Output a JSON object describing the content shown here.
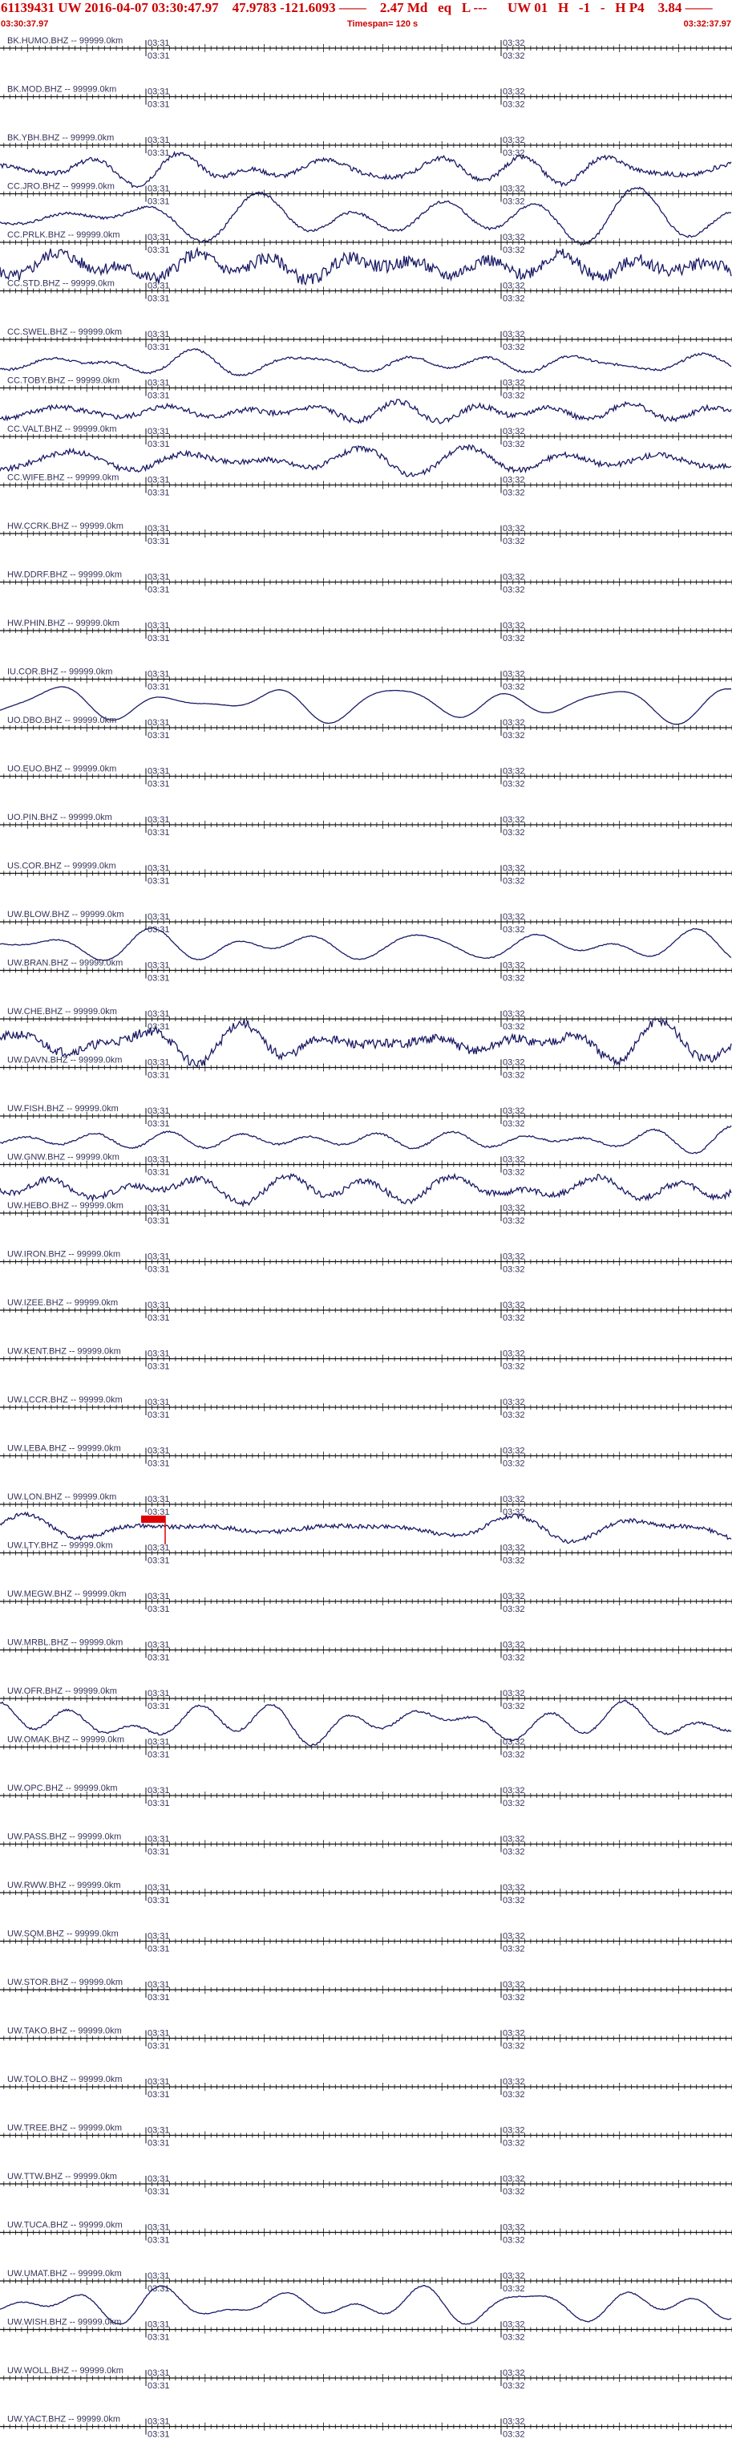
{
  "header": {
    "title": "61139431 UW 2016-04-07 03:30:47.97    47.9783 -121.6093 ——    2.47 Md   eq   L ---      UW 01   H   -1   -   H P4    3.84 ——",
    "start_time": "03:30:37.97",
    "timespan": "Timespan= 120 s",
    "end_time": "03:32:37.97"
  },
  "colors": {
    "header_text": "#cc0000",
    "trace": "#1a1a66",
    "axis": "#111111",
    "label": "#33335a",
    "pick": "#dd0000"
  },
  "chart_data": {
    "type": "line",
    "title": "61139431 UW 2016-04-07 03:30:47.97",
    "timespan_s": 120,
    "minute_labels": [
      "03:31",
      "03:32"
    ],
    "stations": [
      {
        "name": "BK.HUMO.BHZ -- 99999.0km",
        "active": false,
        "amplitude": 0,
        "seed": 1,
        "noise": 0
      },
      {
        "name": "BK.MOD.BHZ -- 99999.0km",
        "active": false,
        "amplitude": 0,
        "seed": 2,
        "noise": 0
      },
      {
        "name": "BK.YBH.BHZ -- 99999.0km",
        "active": true,
        "amplitude": 14,
        "seed": 3,
        "noise": 0.25
      },
      {
        "name": "CC.JRO.BHZ -- 99999.0km",
        "active": true,
        "amplitude": 20,
        "seed": 4,
        "noise": 0.1
      },
      {
        "name": "CC.PRLK.BHZ -- 99999.0km",
        "active": true,
        "amplitude": 16,
        "seed": 5,
        "noise": 0.6
      },
      {
        "name": "CC.STD.BHZ -- 99999.0km",
        "active": false,
        "amplitude": 0,
        "seed": 6,
        "noise": 0
      },
      {
        "name": "CC.SWEL.BHZ -- 99999.0km",
        "active": true,
        "amplitude": 12,
        "seed": 7,
        "noise": 0.15
      },
      {
        "name": "CC.TOBY.BHZ -- 99999.0km",
        "active": true,
        "amplitude": 12,
        "seed": 8,
        "noise": 0.35
      },
      {
        "name": "CC.VALT.BHZ -- 99999.0km",
        "active": true,
        "amplitude": 14,
        "seed": 9,
        "noise": 0.3
      },
      {
        "name": "CC.WIFE.BHZ -- 99999.0km",
        "active": false,
        "amplitude": 0,
        "seed": 10,
        "noise": 0
      },
      {
        "name": "HW.CCRK.BHZ -- 99999.0km",
        "active": false,
        "amplitude": 0,
        "seed": 11,
        "noise": 0
      },
      {
        "name": "HW.DDRF.BHZ -- 99999.0km",
        "active": false,
        "amplitude": 0,
        "seed": 12,
        "noise": 0
      },
      {
        "name": "HW.PHIN.BHZ -- 99999.0km",
        "active": false,
        "amplitude": 0,
        "seed": 13,
        "noise": 0
      },
      {
        "name": "IU.COR.BHZ -- 99999.0km",
        "active": true,
        "amplitude": 14,
        "seed": 14,
        "noise": 0.02
      },
      {
        "name": "UO.DBO.BHZ -- 99999.0km",
        "active": false,
        "amplitude": 0,
        "seed": 15,
        "noise": 0
      },
      {
        "name": "UO.EUO.BHZ -- 99999.0km",
        "active": false,
        "amplitude": 0,
        "seed": 16,
        "noise": 0
      },
      {
        "name": "UO.PIN.BHZ -- 99999.0km",
        "active": false,
        "amplitude": 0,
        "seed": 17,
        "noise": 0
      },
      {
        "name": "US.COR.BHZ -- 99999.0km",
        "active": false,
        "amplitude": 0,
        "seed": 18,
        "noise": 0
      },
      {
        "name": "UW.BLOW.BHZ -- 99999.0km",
        "active": true,
        "amplitude": 14,
        "seed": 19,
        "noise": 0.05
      },
      {
        "name": "UW.BRAN.BHZ -- 99999.0km",
        "active": false,
        "amplitude": 0,
        "seed": 20,
        "noise": 0
      },
      {
        "name": "UW.CHE.BHZ -- 99999.0km",
        "active": true,
        "amplitude": 18,
        "seed": 21,
        "noise": 0.4
      },
      {
        "name": "UW.DAVN.BHZ -- 99999.0km",
        "active": false,
        "amplitude": 0,
        "seed": 22,
        "noise": 0
      },
      {
        "name": "UW.FISH.BHZ -- 99999.0km",
        "active": true,
        "amplitude": 14,
        "seed": 23,
        "noise": 0.1
      },
      {
        "name": "UW.GNW.BHZ -- 99999.0km",
        "active": true,
        "amplitude": 16,
        "seed": 24,
        "noise": 0.3
      },
      {
        "name": "UW.HEBO.BHZ -- 99999.0km",
        "active": false,
        "amplitude": 0,
        "seed": 25,
        "noise": 0
      },
      {
        "name": "UW.IRON.BHZ -- 99999.0km",
        "active": false,
        "amplitude": 0,
        "seed": 26,
        "noise": 0
      },
      {
        "name": "UW.IZEE.BHZ -- 99999.0km",
        "active": false,
        "amplitude": 0,
        "seed": 27,
        "noise": 0
      },
      {
        "name": "UW.KENT.BHZ -- 99999.0km",
        "active": false,
        "amplitude": 0,
        "seed": 28,
        "noise": 0
      },
      {
        "name": "UW.LCCR.BHZ -- 99999.0km",
        "active": false,
        "amplitude": 0,
        "seed": 29,
        "noise": 0
      },
      {
        "name": "UW.LEBA.BHZ -- 99999.0km",
        "active": false,
        "amplitude": 0,
        "seed": 30,
        "noise": 0
      },
      {
        "name": "UW.LON.BHZ -- 99999.0km",
        "active": true,
        "amplitude": 13,
        "seed": 31,
        "noise": 0.25,
        "pick": true
      },
      {
        "name": "UW.LTY.BHZ -- 99999.0km",
        "active": false,
        "amplitude": 0,
        "seed": 32,
        "noise": 0
      },
      {
        "name": "UW.MEGW.BHZ -- 99999.0km",
        "active": false,
        "amplitude": 0,
        "seed": 33,
        "noise": 0
      },
      {
        "name": "UW.MRBL.BHZ -- 99999.0km",
        "active": false,
        "amplitude": 0,
        "seed": 34,
        "noise": 0
      },
      {
        "name": "UW.OFR.BHZ -- 99999.0km",
        "active": true,
        "amplitude": 16,
        "seed": 35,
        "noise": 0.1
      },
      {
        "name": "UW.OMAK.BHZ -- 99999.0km",
        "active": false,
        "amplitude": 0,
        "seed": 36,
        "noise": 0
      },
      {
        "name": "UW.OPC.BHZ -- 99999.0km",
        "active": false,
        "amplitude": 0,
        "seed": 37,
        "noise": 0
      },
      {
        "name": "UW.PASS.BHZ -- 99999.0km",
        "active": false,
        "amplitude": 0,
        "seed": 38,
        "noise": 0
      },
      {
        "name": "UW.RWW.BHZ -- 99999.0km",
        "active": false,
        "amplitude": 0,
        "seed": 39,
        "noise": 0
      },
      {
        "name": "UW.SQM.BHZ -- 99999.0km",
        "active": false,
        "amplitude": 0,
        "seed": 40,
        "noise": 0
      },
      {
        "name": "UW.STOR.BHZ -- 99999.0km",
        "active": false,
        "amplitude": 0,
        "seed": 41,
        "noise": 0
      },
      {
        "name": "UW.TAKO.BHZ -- 99999.0km",
        "active": false,
        "amplitude": 0,
        "seed": 42,
        "noise": 0
      },
      {
        "name": "UW.TOLO.BHZ -- 99999.0km",
        "active": false,
        "amplitude": 0,
        "seed": 43,
        "noise": 0
      },
      {
        "name": "UW.TREE.BHZ -- 99999.0km",
        "active": false,
        "amplitude": 0,
        "seed": 44,
        "noise": 0
      },
      {
        "name": "UW.TTW.BHZ -- 99999.0km",
        "active": false,
        "amplitude": 0,
        "seed": 45,
        "noise": 0
      },
      {
        "name": "UW.TUCA.BHZ -- 99999.0km",
        "active": false,
        "amplitude": 0,
        "seed": 46,
        "noise": 0
      },
      {
        "name": "UW.UMAT.BHZ -- 99999.0km",
        "active": true,
        "amplitude": 15,
        "seed": 47,
        "noise": 0.05
      },
      {
        "name": "UW.WISH.BHZ -- 99999.0km",
        "active": false,
        "amplitude": 0,
        "seed": 48,
        "noise": 0
      },
      {
        "name": "UW.WOLL.BHZ -- 99999.0km",
        "active": false,
        "amplitude": 0,
        "seed": 49,
        "noise": 0
      },
      {
        "name": "UW.YACT.BHZ -- 99999.0km",
        "active": false,
        "amplitude": 0,
        "seed": 50,
        "noise": 0
      }
    ]
  }
}
